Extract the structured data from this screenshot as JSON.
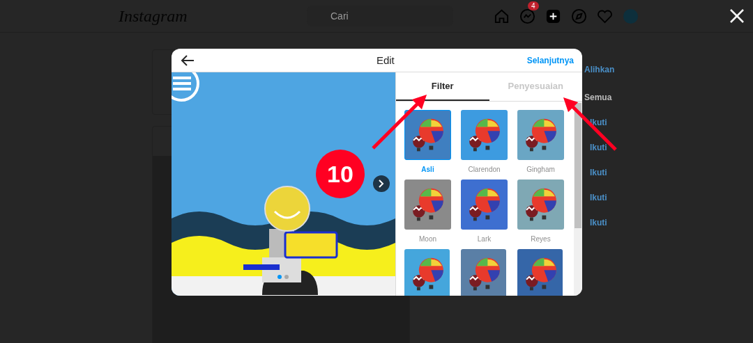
{
  "background_page": {
    "logo": "Instagram",
    "search": {
      "placeholder": "Cari"
    },
    "messages_badge": "4",
    "suggestions": {
      "switch_link": "Alihkan",
      "see_all_link": "Semua",
      "follow_links": [
        "Ikuti",
        "Ikuti",
        "Ikuti",
        "Ikuti",
        "Ikuti"
      ]
    }
  },
  "dialog": {
    "title": "Edit",
    "next_button": "Selanjutnya",
    "carousel_dots": [
      {
        "selected": true
      },
      {
        "selected": false
      }
    ],
    "tabs": [
      {
        "label": "Filter",
        "selected": true
      },
      {
        "label": "Penyesuaian",
        "selected": false
      }
    ],
    "filters": [
      {
        "label": "Asli",
        "selected": true,
        "color": "#3f7fc0"
      },
      {
        "label": "Clarendon",
        "selected": false,
        "color": "#3d9be0"
      },
      {
        "label": "Gingham",
        "selected": false,
        "color": "#6aa6c4"
      },
      {
        "label": "Moon",
        "selected": false,
        "color": "#8a8a8a"
      },
      {
        "label": "Lark",
        "selected": false,
        "color": "#3e6fd0"
      },
      {
        "label": "Reyes",
        "selected": false,
        "color": "#7fa8b4"
      },
      {
        "selected": false,
        "color": "#45a6dc"
      },
      {
        "selected": false,
        "color": "#5a7fa6"
      },
      {
        "selected": false,
        "color": "#3566a8"
      }
    ]
  },
  "annotation": {
    "step_number": "10"
  }
}
